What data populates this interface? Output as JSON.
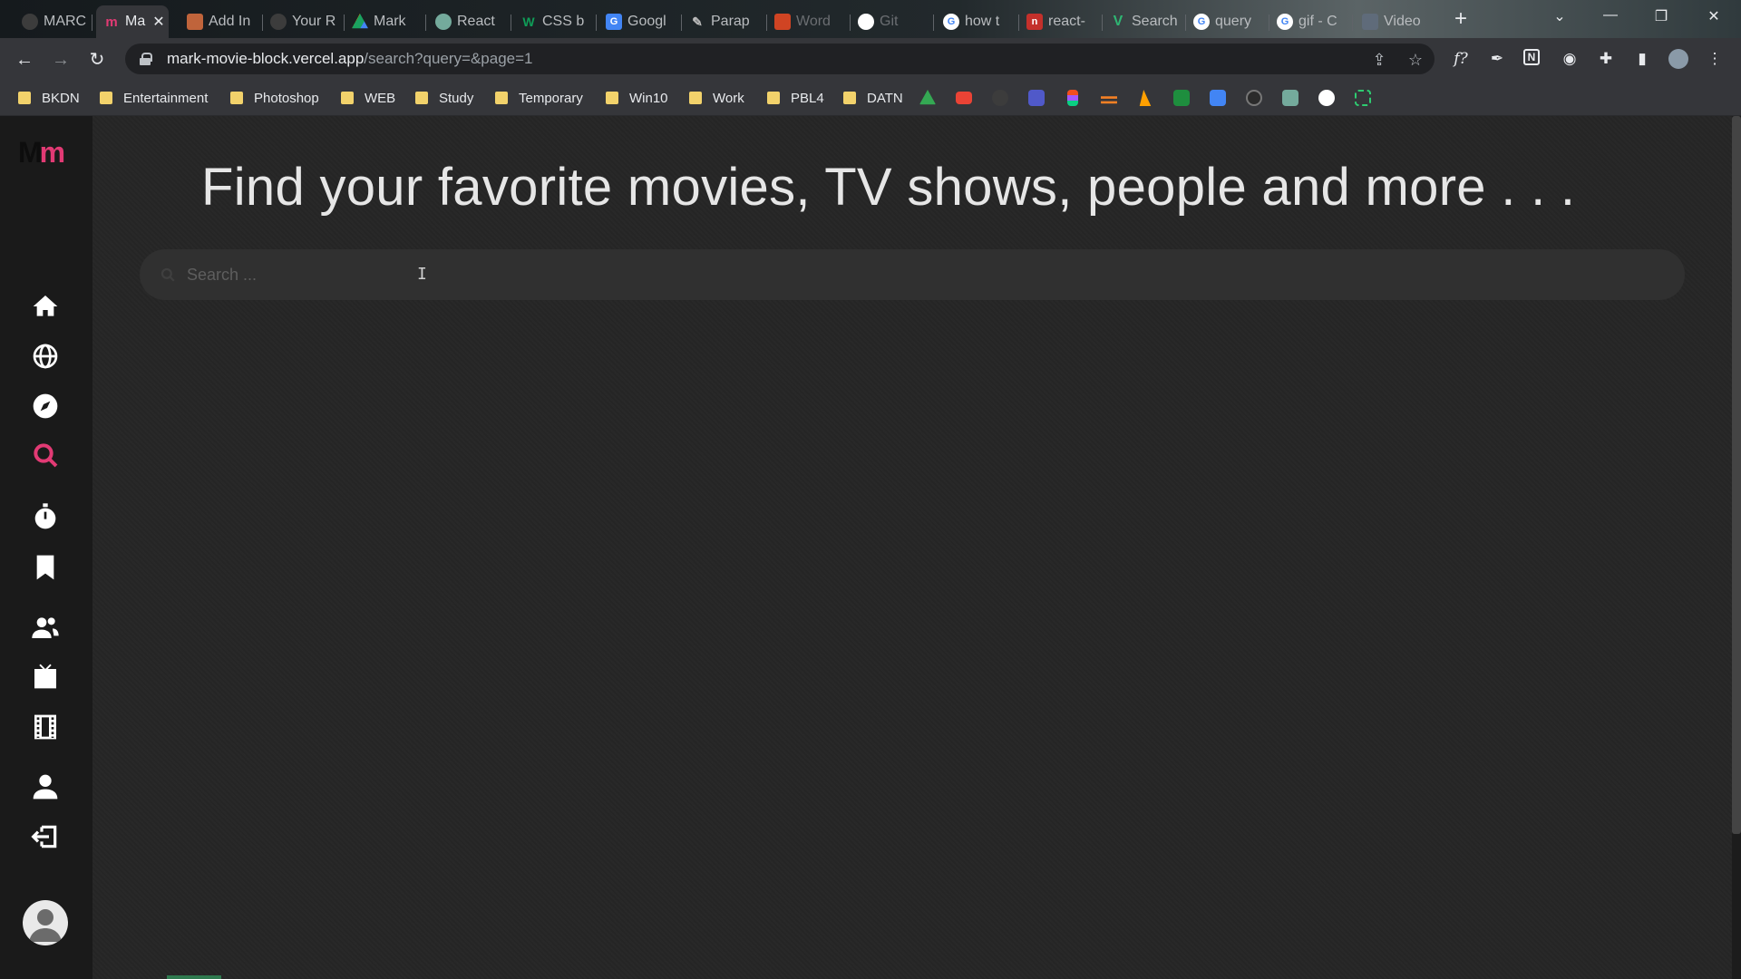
{
  "browser": {
    "tabs": [
      {
        "label": "MARC",
        "color": "#3c3c3c",
        "glyph": ""
      },
      {
        "label": "Ma",
        "color": "#e23a74",
        "glyph": "m",
        "active": true
      },
      {
        "label": "Add In",
        "color": "#c0643b",
        "glyph": ""
      },
      {
        "label": "Your R",
        "color": "#3c3c3c",
        "glyph": ""
      },
      {
        "label": "Mark",
        "color": "#1aa260",
        "glyph": ""
      },
      {
        "label": "React",
        "color": "#74aa9c",
        "glyph": ""
      },
      {
        "label": "CSS b",
        "color": "#0f9d58",
        "glyph": "W"
      },
      {
        "label": "Googl",
        "color": "#4285f4",
        "glyph": "G"
      },
      {
        "label": "Parap",
        "color": "#555",
        "glyph": ""
      },
      {
        "label": "Word",
        "color": "#d04423",
        "glyph": ""
      },
      {
        "label": "Git",
        "color": "#ffffff",
        "glyph": ""
      },
      {
        "label": "how t",
        "color": "#4285f4",
        "glyph": "G"
      },
      {
        "label": "react-",
        "color": "#c4302b",
        "glyph": "n"
      },
      {
        "label": "Search",
        "color": "#2fb673",
        "glyph": "V"
      },
      {
        "label": "query",
        "color": "#4285f4",
        "glyph": "G"
      },
      {
        "label": "gif - C",
        "color": "#4285f4",
        "glyph": "G"
      },
      {
        "label": "Video",
        "color": "#5f6b7a",
        "glyph": ""
      }
    ],
    "new_tab": "+",
    "url_host": "mark-movie-block.vercel.app",
    "url_path": "/search?query=&page=1",
    "bookmarks": [
      "BKDN",
      "Entertainment",
      "Photoshop",
      "WEB",
      "Study",
      "Temporary",
      "Win10",
      "Work",
      "PBL4",
      "DATN"
    ],
    "bookmark_icons": [
      {
        "name": "google-drive-icon",
        "color": "#34a853"
      },
      {
        "name": "gmail-icon",
        "color": "#ea4335"
      },
      {
        "name": "github-icon",
        "color": "#3c3c3c"
      },
      {
        "name": "teams-icon",
        "color": "#5059c9"
      },
      {
        "name": "figma-icon",
        "color": "#f24e1e"
      },
      {
        "name": "stack-icon",
        "color": "#f48024"
      },
      {
        "name": "firebase-icon",
        "color": "#ffa000"
      },
      {
        "name": "green-app-icon",
        "color": "#1e8e3e"
      },
      {
        "name": "translate-icon",
        "color": "#4285f4"
      },
      {
        "name": "openai-icon",
        "color": "#2b2b2b"
      },
      {
        "name": "chatgpt-icon",
        "color": "#74aa9c"
      },
      {
        "name": "vercel-icon",
        "color": "#ffffff"
      },
      {
        "name": "green-frame-icon",
        "color": "#2ecc71"
      }
    ]
  },
  "app": {
    "logo_first": "M",
    "logo_second": "m",
    "accent_color": "#e23a74",
    "nav": [
      "home-icon",
      "globe-icon",
      "compass-icon",
      "search-icon",
      "stopwatch-icon",
      "bookmark-icon",
      "users-icon",
      "tv-icon",
      "film-icon",
      "user-icon",
      "logout-icon"
    ],
    "heading": "Find your favorite movies, TV shows, people and more . . .",
    "search_placeholder": "Search ...",
    "search_value": ""
  }
}
